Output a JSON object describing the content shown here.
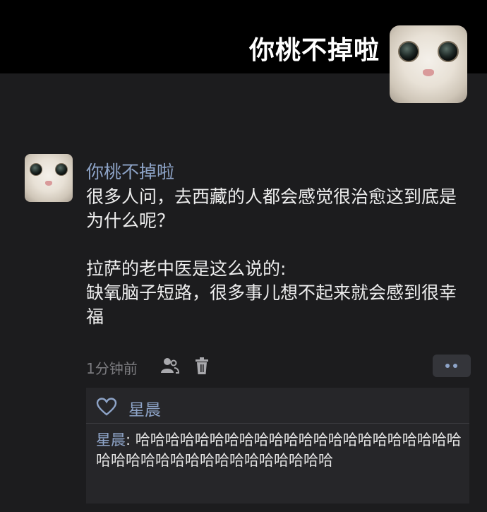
{
  "profile": {
    "name": "你桃不掉啦"
  },
  "post": {
    "author": "你桃不掉啦",
    "text": "很多人问，去西藏的人都会感觉很治愈这到底是为什么呢？\n\n拉萨的老中医是这么说的:\n缺氧脑子短路，很多事儿想不起来就会感到很幸福",
    "timestamp": "1分钟前",
    "icons": [
      "friend-visibility-icon",
      "trash-icon",
      "more-dots-icon"
    ]
  },
  "likes": {
    "icon": "heart-icon",
    "names": "星晨"
  },
  "comments": [
    {
      "author": "星晨",
      "separator": ": ",
      "text": "哈哈哈哈哈哈哈哈哈哈哈哈哈哈哈哈哈哈哈哈哈哈哈哈哈哈哈哈哈哈哈哈哈哈哈哈哈哈"
    }
  ],
  "colors": {
    "background": "#1c1c1e",
    "header": "#000000",
    "link": "#8ea4c8",
    "comment_box": "#262629"
  }
}
